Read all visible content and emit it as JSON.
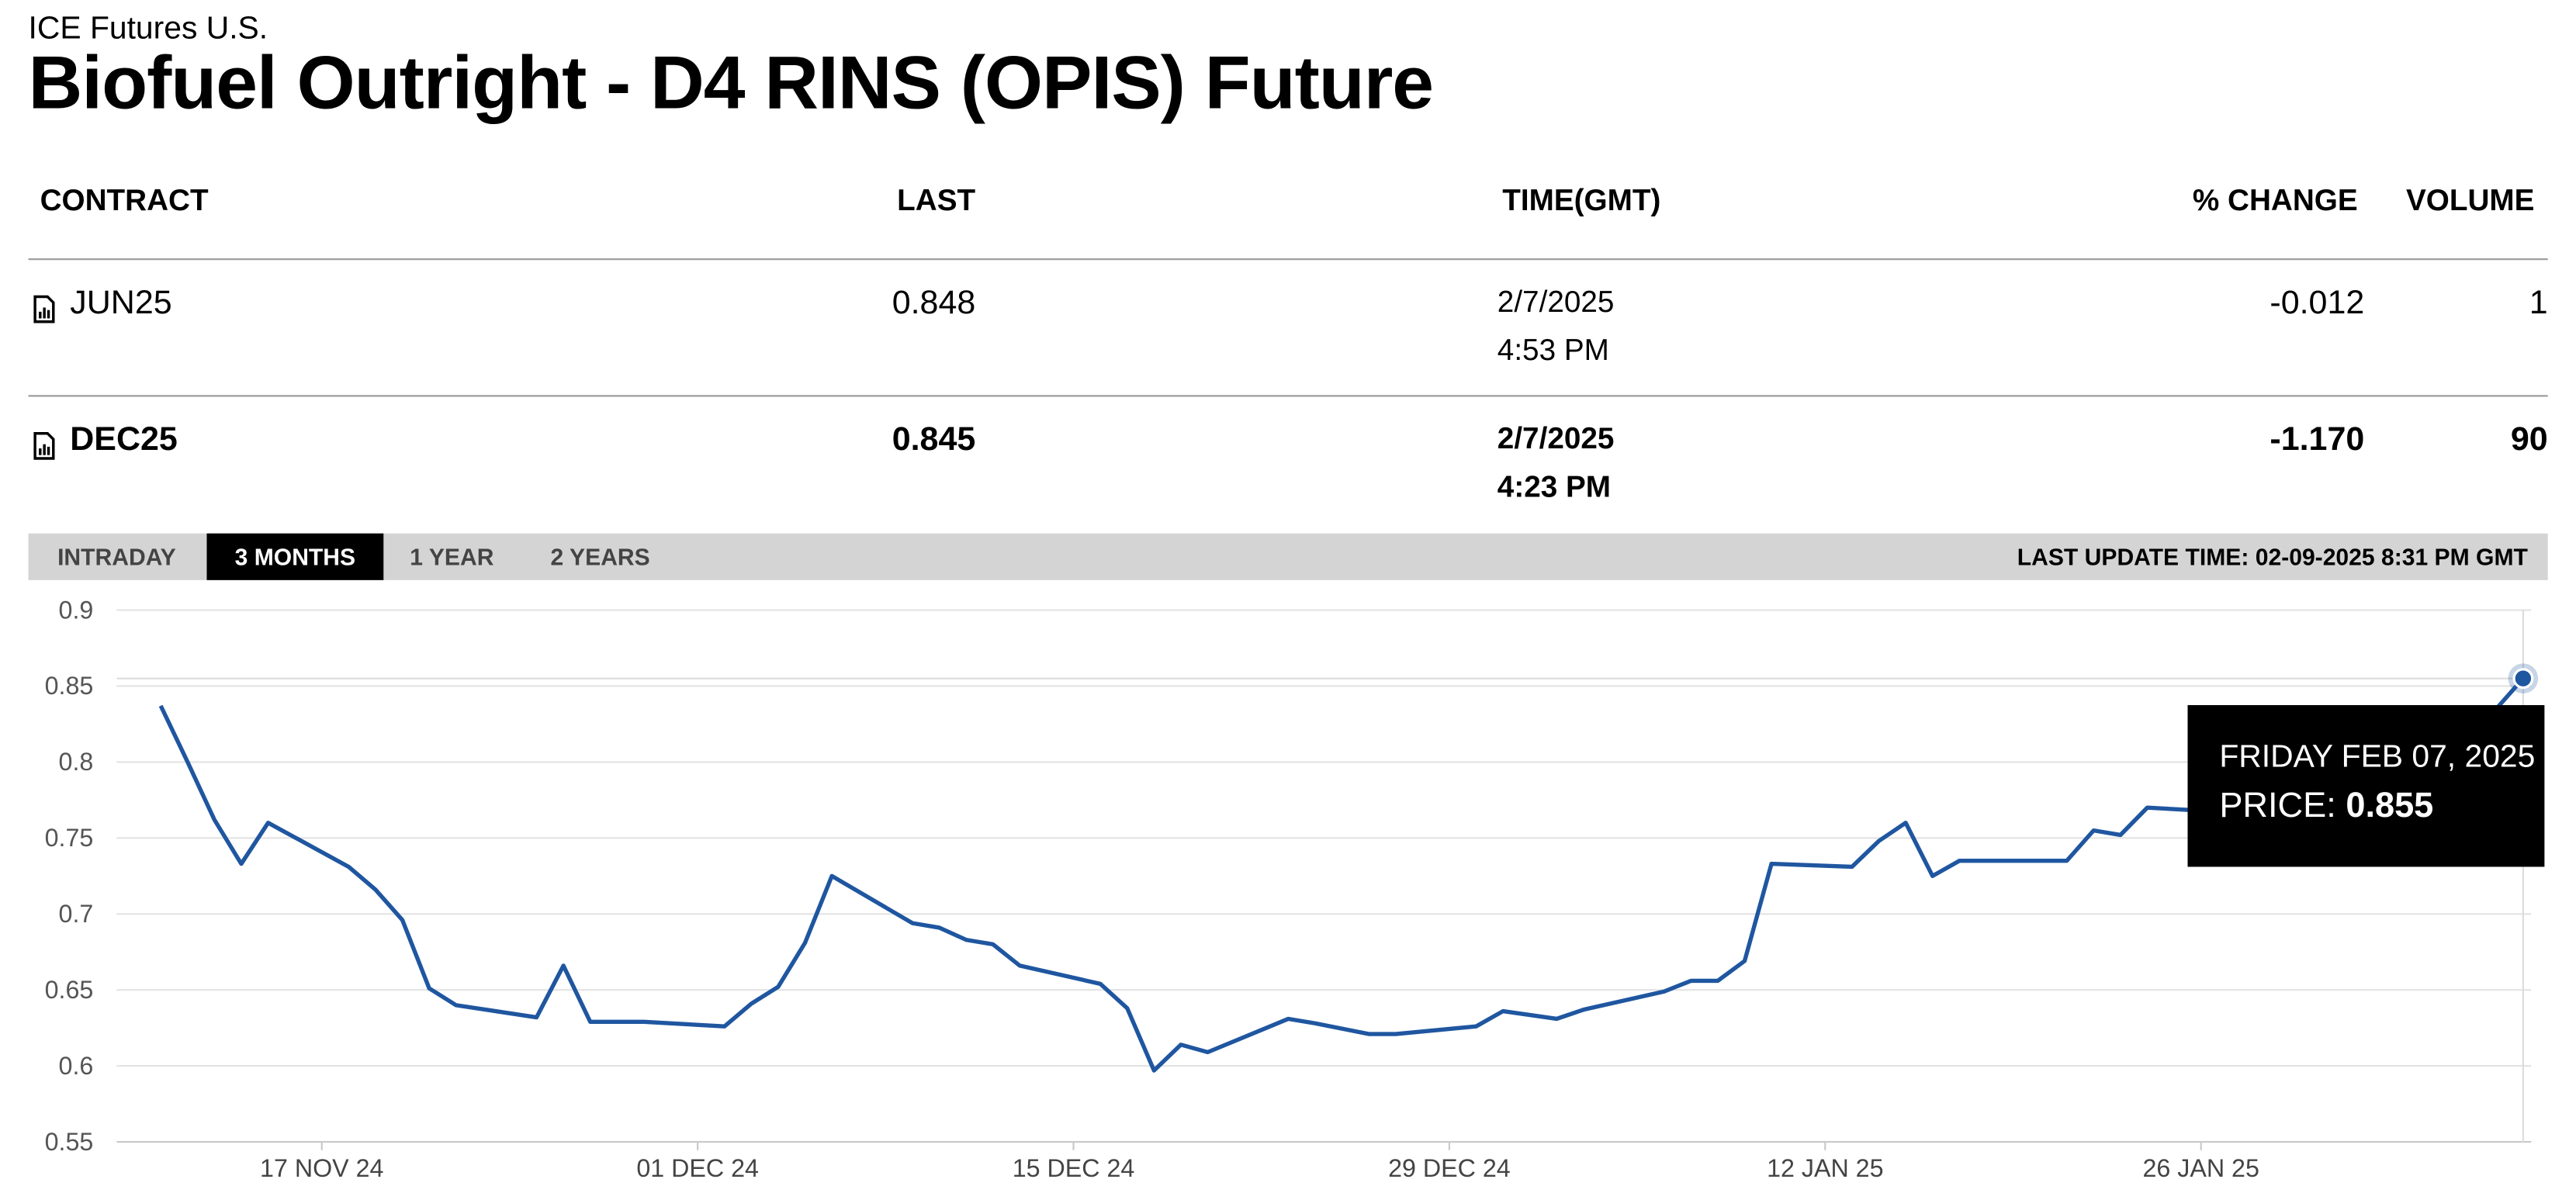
{
  "header": {
    "exchange": "ICE Futures U.S.",
    "title": "Biofuel Outright - D4 RINS (OPIS) Future"
  },
  "table": {
    "columns": {
      "contract": "CONTRACT",
      "last": "LAST",
      "time": "TIME(GMT)",
      "change": "% CHANGE",
      "volume": "VOLUME"
    },
    "rows": [
      {
        "contract": "JUN25",
        "last": "0.848",
        "date": "2/7/2025",
        "time": "4:53 PM",
        "change": "-0.012",
        "volume": "1",
        "icon": "chart-doc-icon"
      },
      {
        "contract": "DEC25",
        "last": "0.845",
        "date": "2/7/2025",
        "time": "4:23 PM",
        "change": "-1.170",
        "volume": "90",
        "icon": "chart-doc-icon"
      }
    ]
  },
  "chart_tabs": {
    "items": [
      "INTRADAY",
      "3 MONTHS",
      "1 YEAR",
      "2 YEARS"
    ],
    "active": "3 MONTHS",
    "last_update": "LAST UPDATE TIME: 02-09-2025 8:31 PM GMT"
  },
  "tooltip": {
    "date": "FRIDAY FEB 07, 2025",
    "price_label": "PRICE:",
    "price": "0.855"
  },
  "colors": {
    "line": "#1f56a0",
    "tab_bar": "#d4d4d4",
    "tooltip_bg": "#000000"
  },
  "chart_data": {
    "type": "line",
    "title": "",
    "xlabel": "",
    "ylabel": "",
    "ylim": [
      0.55,
      0.9
    ],
    "yticks": [
      0.55,
      0.6,
      0.65,
      0.7,
      0.75,
      0.8,
      0.85,
      0.9
    ],
    "ytick_labels": [
      "0.55",
      "0.6",
      "0.65",
      "0.7",
      "0.75",
      "0.8",
      "0.85",
      "0.9"
    ],
    "xticks": [
      "2024-11-17",
      "2024-12-01",
      "2024-12-15",
      "2024-12-29",
      "2025-01-12",
      "2025-01-26"
    ],
    "xtick_labels": [
      "17 NOV 24",
      "01 DEC 24",
      "15 DEC 24",
      "29 DEC 24",
      "12 JAN 25",
      "26 JAN 25"
    ],
    "grid": true,
    "legend": "none",
    "series": [
      {
        "x": [
          "2024-11-11",
          "2024-11-12",
          "2024-11-13",
          "2024-11-14",
          "2024-11-15",
          "2024-11-18",
          "2024-11-19",
          "2024-11-20",
          "2024-11-21",
          "2024-11-22",
          "2024-11-25",
          "2024-11-26",
          "2024-11-27",
          "2024-11-29",
          "2024-12-02",
          "2024-12-03",
          "2024-12-04",
          "2024-12-05",
          "2024-12-06",
          "2024-12-09",
          "2024-12-10",
          "2024-12-11",
          "2024-12-12",
          "2024-12-13",
          "2024-12-16",
          "2024-12-17",
          "2024-12-18",
          "2024-12-19",
          "2024-12-20",
          "2024-12-23",
          "2024-12-24",
          "2024-12-26",
          "2024-12-27",
          "2024-12-30",
          "2024-12-31",
          "2025-01-02",
          "2025-01-03",
          "2025-01-06",
          "2025-01-07",
          "2025-01-08",
          "2025-01-09",
          "2025-01-10",
          "2025-01-13",
          "2025-01-14",
          "2025-01-15",
          "2025-01-16",
          "2025-01-17",
          "2025-01-21",
          "2025-01-22",
          "2025-01-23",
          "2025-01-24",
          "2025-01-27",
          "2025-01-28",
          "2025-01-29",
          "2025-01-30",
          "2025-01-31",
          "2025-02-03",
          "2025-02-04",
          "2025-02-05",
          "2025-02-06",
          "2025-02-07"
        ],
        "y": [
          0.837,
          0.8,
          0.762,
          0.733,
          0.76,
          0.731,
          0.716,
          0.696,
          0.651,
          0.64,
          0.632,
          0.666,
          0.629,
          0.629,
          0.626,
          0.641,
          0.652,
          0.681,
          0.725,
          0.694,
          0.691,
          0.683,
          0.68,
          0.666,
          0.654,
          0.638,
          0.597,
          0.614,
          0.609,
          0.631,
          0.628,
          0.621,
          0.621,
          0.626,
          0.636,
          0.631,
          0.637,
          0.649,
          0.656,
          0.656,
          0.669,
          0.733,
          0.731,
          0.748,
          0.76,
          0.725,
          0.735,
          0.735,
          0.755,
          0.752,
          0.77,
          0.767,
          0.764,
          0.77,
          0.774,
          0.775,
          0.778,
          0.781,
          0.801,
          0.835,
          0.855
        ]
      }
    ]
  }
}
